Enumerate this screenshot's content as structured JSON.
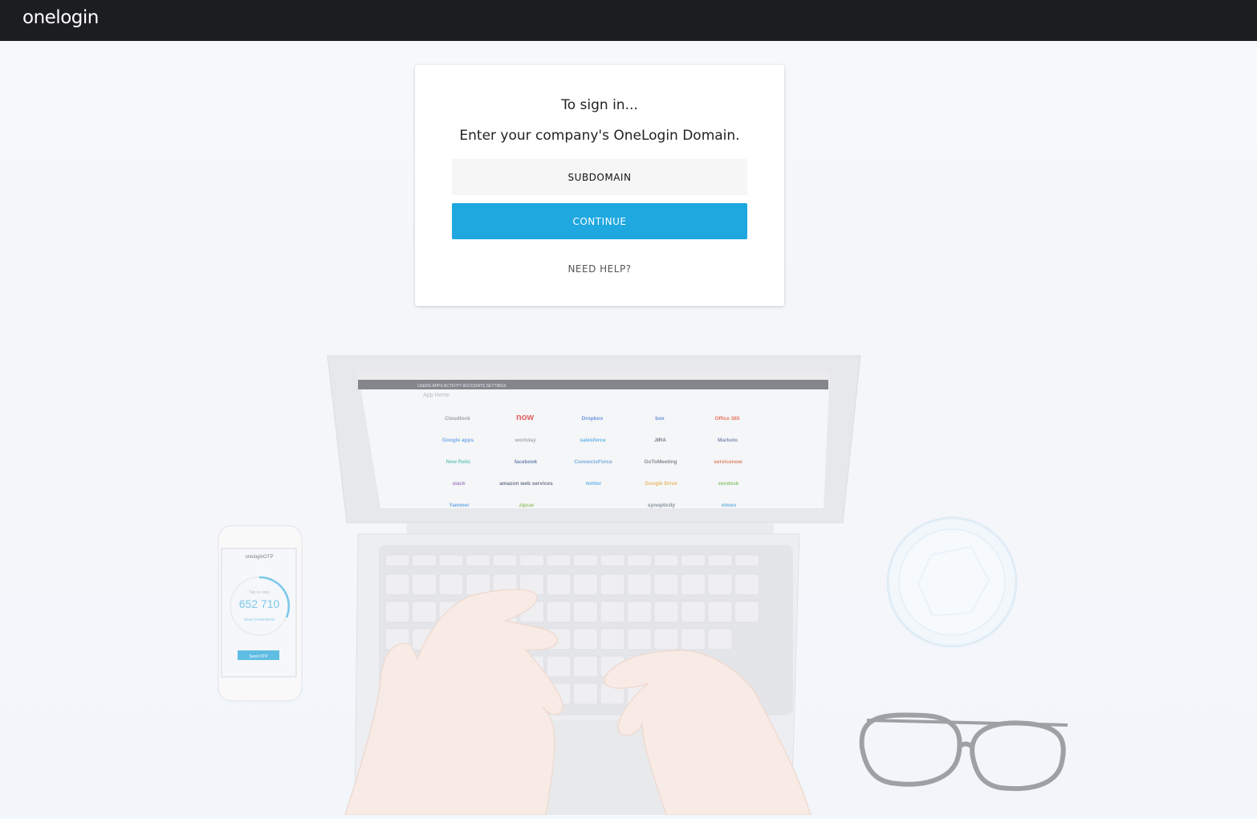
{
  "header": {
    "logo_text": "onelogin"
  },
  "signin": {
    "title": "To sign in...",
    "subtitle": "Enter your company's OneLogin Domain.",
    "subdomain_placeholder": "SUBDOMAIN",
    "continue_label": "CONTINUE",
    "help_label": "NEED HELP?"
  },
  "background": {
    "laptop_screen": {
      "nav": [
        "USERS",
        "APPS",
        "ACTIVITY",
        "ACCOUNTS",
        "SETTINGS"
      ],
      "page_title": "App Home",
      "apps": [
        "Cloudlock",
        "now",
        "Dropbox",
        "box",
        "Office 365",
        "Google apps",
        "workday",
        "salesforce",
        "JIRA",
        "Marketo",
        "New Relic",
        "facebook",
        "ConnectsForce",
        "GoToMeeting",
        "servicenow",
        "slack",
        "amazon web services",
        "twitter",
        "Google Drive",
        "zendesk",
        "Yammer",
        "zipcar",
        "",
        "synopticity",
        "vimeo"
      ]
    },
    "phone": {
      "brand": "oneloginOTP",
      "caption": "Tap to copy",
      "otp_code": "652 710",
      "link": "Show Credential ID",
      "button": "Send OTP"
    },
    "colors": {
      "accent": "#1ea8df",
      "header": "#1c1d20"
    }
  }
}
